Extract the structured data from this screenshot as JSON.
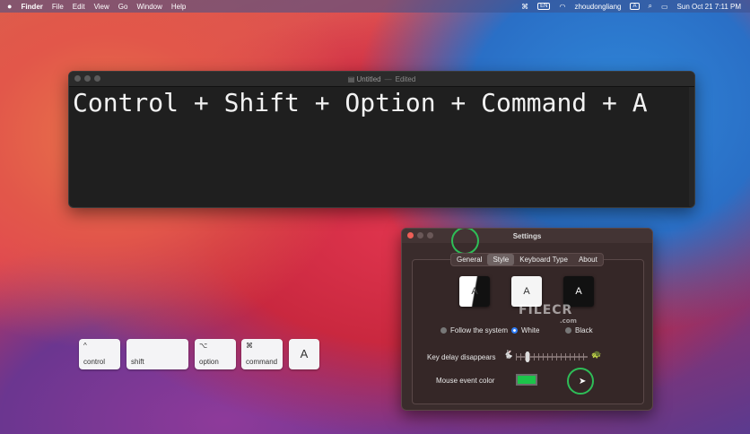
{
  "menubar": {
    "apple": "",
    "app": "Finder",
    "items": [
      "File",
      "Edit",
      "View",
      "Go",
      "Window",
      "Help"
    ],
    "status_badge": "EN",
    "user": "zhoudongliang",
    "input_badge": "A",
    "clock": "Sun Oct 21  7:11 PM"
  },
  "editor": {
    "title": "Untitled",
    "status": "Edited",
    "content": "Control + Shift + Option + Command + A"
  },
  "keys": [
    {
      "symbol": "^",
      "label": "control"
    },
    {
      "symbol": "",
      "label": "shift"
    },
    {
      "symbol": "⌥",
      "label": "option"
    },
    {
      "symbol": "⌘",
      "label": "command"
    },
    {
      "symbol": "",
      "label": "A"
    }
  ],
  "settings": {
    "title": "Settings",
    "tabs": [
      "General",
      "Style",
      "Keyboard Type",
      "About"
    ],
    "active_tab": "Style",
    "theme_preview_letter": "A",
    "themes": [
      "Follow the system",
      "White",
      "Black"
    ],
    "selected_theme": "White",
    "key_delay_label": "Key delay disappears",
    "key_delay_level": 0.15,
    "mouse_color_label": "Mouse event color",
    "mouse_color": "#1cc44a"
  },
  "watermark": {
    "text": "FILECR",
    "sub": ".com"
  }
}
